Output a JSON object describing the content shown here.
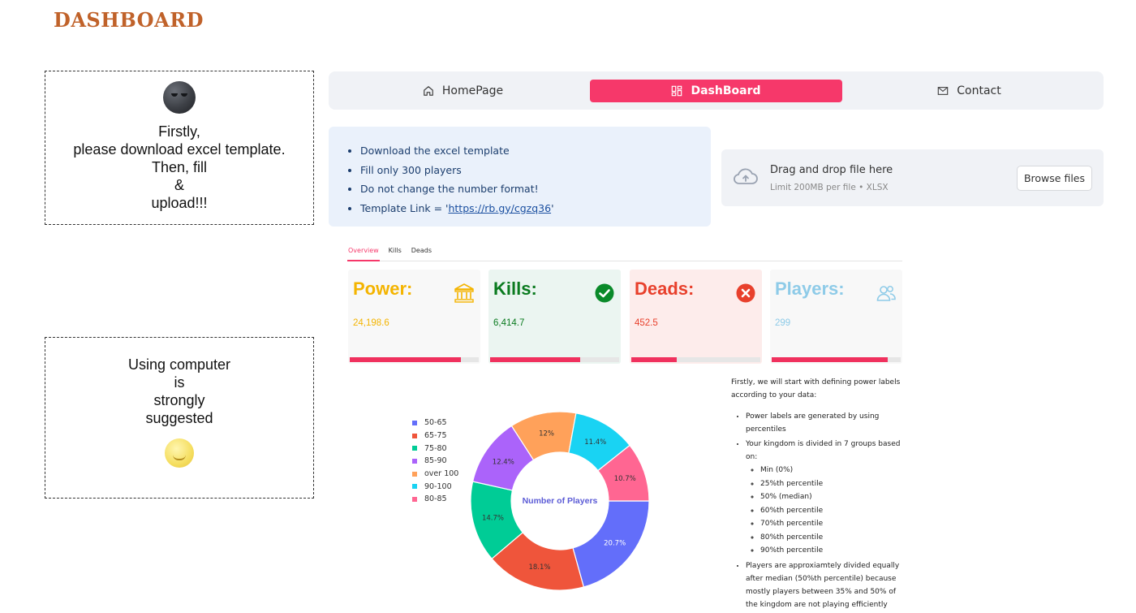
{
  "page": {
    "title": "DASHBOARD"
  },
  "notes": {
    "first": {
      "icon": "new-moon-face-icon",
      "lines": [
        "Firstly,",
        "please download excel template.",
        "Then, fill",
        "&",
        "upload!!!"
      ]
    },
    "second": {
      "icon": "full-moon-face-icon",
      "lines": [
        "Using computer",
        "is",
        "strongly",
        "suggested"
      ]
    }
  },
  "nav": {
    "items": [
      {
        "label": "HomePage",
        "icon": "home-icon"
      },
      {
        "label": "DashBoard",
        "icon": "dashboard-grid-icon",
        "active": true
      },
      {
        "label": "Contact",
        "icon": "envelope-icon"
      }
    ]
  },
  "info": {
    "items": [
      "Download the excel template",
      "Fill only 300 players",
      "Do not change the number format!"
    ],
    "link_prefix": "Template Link = '",
    "link_text": "https://rb.gy/cgzq36",
    "link_suffix": "'"
  },
  "upload": {
    "title": "Drag and drop file here",
    "subtitle": "Limit 200MB per file • XLSX",
    "button": "Browse files"
  },
  "tabs": [
    "Overview",
    "Kills",
    "Deads"
  ],
  "cards": [
    {
      "title": "Power:",
      "value": "24,198.6",
      "color": "#f4b400",
      "icon": "bank-icon",
      "progress": 0.86
    },
    {
      "title": "Kills:",
      "value": "6,414.7",
      "color": "#0a7a1f",
      "icon": "check-circle-icon",
      "progress": 0.7
    },
    {
      "title": "Deads:",
      "value": "452.5",
      "color": "#e8402c",
      "icon": "x-circle-icon",
      "progress": 0.35
    },
    {
      "title": "Players:",
      "value": "299",
      "color": "#8ecbe8",
      "icon": "users-icon",
      "progress": 0.9
    }
  ],
  "chart_data": {
    "type": "pie",
    "donut": true,
    "center_label": "Number of Players",
    "slices": [
      {
        "label": "50-65",
        "value": 20.7,
        "text": "20.7%",
        "color": "#636efa"
      },
      {
        "label": "65-75",
        "value": 18.1,
        "text": "18.1%",
        "color": "#ef553b"
      },
      {
        "label": "75-80",
        "value": 14.7,
        "text": "14.7%",
        "color": "#00cc96"
      },
      {
        "label": "85-90",
        "value": 12.4,
        "text": "12.4%",
        "color": "#ab63fa"
      },
      {
        "label": "over 100",
        "value": 12,
        "text": "12%",
        "color": "#ffa15a"
      },
      {
        "label": "90-100",
        "value": 11.4,
        "text": "11.4%",
        "color": "#19d3f3"
      },
      {
        "label": "80-85",
        "value": 10.7,
        "text": "10.7%",
        "color": "#ff6692"
      }
    ],
    "legend_position": "left"
  },
  "explain": {
    "intro": "Firstly, we will start with defining power labels according to your data:",
    "bullet1": "Power labels are generated by using percentiles",
    "bullet2": "Your kingdom is divided in 7 groups based on:",
    "groups": [
      "Min (0%)",
      "25%th percentile",
      "50% (median)",
      "60%th percentile",
      "70%th percentile",
      "80%th percentile",
      "90%th percentile"
    ],
    "bullet3": "Players are approxiamtely divided equally after median (50%th percentile) because mostly players between 35% and 50% of the kingdom are not playing efficiently"
  }
}
